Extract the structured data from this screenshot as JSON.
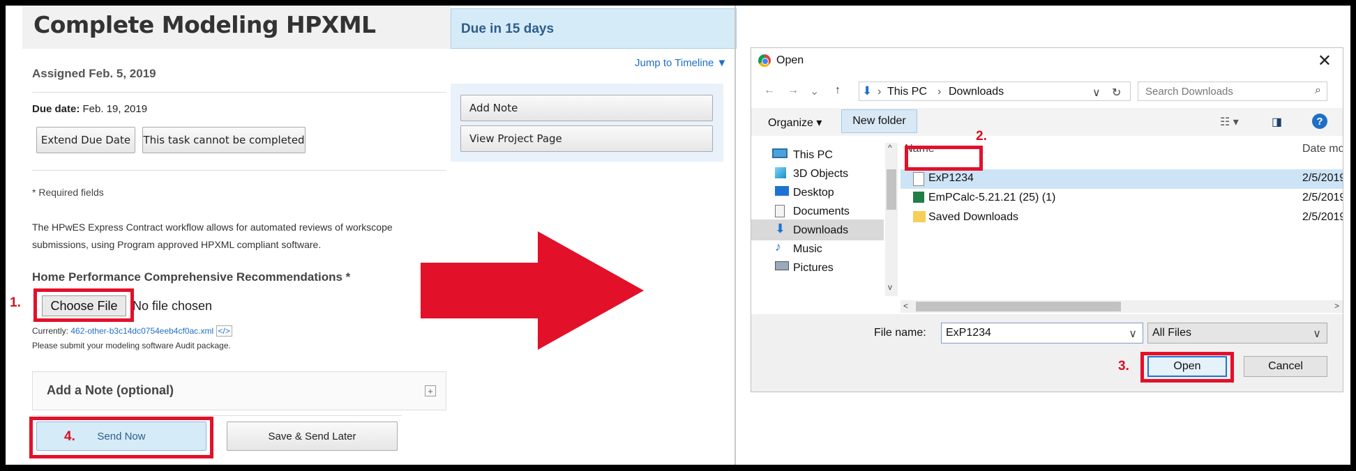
{
  "left": {
    "title": "Complete Modeling HPXML",
    "due_badge": "Due in 15 days",
    "jump_link": "Jump to Timeline ▼",
    "assigned": "Assigned Feb. 5, 2019",
    "due_date_label": "Due date:",
    "due_date_value": "Feb. 19, 2019",
    "extend_button": "Extend Due Date",
    "cannot_complete_button": "This task cannot be completed",
    "required_note": "* Required fields",
    "description": "The HPwES Express Contract workflow allows for automated reviews of workscope submissions, using Program approved HPXML compliant software.",
    "section_title": "Home Performance Comprehensive Recommendations *",
    "choose_file": "Choose File",
    "no_file": "No file chosen",
    "currently_label": "Currently:",
    "currently_file": "462-other-b3c14dc0754eeb4cf0ac.xml",
    "code_icon_text": "</>",
    "submit_note": "Please submit your modeling software Audit package.",
    "add_note_section": "Add a Note (optional)",
    "plus_icon": "+",
    "send_now": "Send Now",
    "save_later": "Save & Send Later",
    "side_add_note": "Add Note",
    "side_view_project": "View Project Page"
  },
  "steps": {
    "s1": "1.",
    "s2": "2.",
    "s3": "3.",
    "s4": "4."
  },
  "dialog": {
    "title": "Open",
    "close": "✕",
    "back": "←",
    "forward": "→",
    "recent": "⌄",
    "up": "↑",
    "crumbs": [
      "This PC",
      "›",
      "Downloads"
    ],
    "crumb_sep_first": "›",
    "addr_chevron": "∨",
    "refresh": "↻",
    "search_placeholder": "Search Downloads",
    "search_icon": "⌕",
    "organize": "Organize ▾",
    "new_folder": "New folder",
    "view_icon": "☷ ▾",
    "pane_icon": "◨",
    "help": "?",
    "tree": [
      {
        "label": "This PC"
      },
      {
        "label": "3D Objects"
      },
      {
        "label": "Desktop"
      },
      {
        "label": "Documents"
      },
      {
        "label": "Downloads"
      },
      {
        "label": "Music"
      },
      {
        "label": "Pictures"
      }
    ],
    "tree_up": "^",
    "tree_down": "v",
    "col_name": "Name",
    "col_date": "Date mo",
    "files": [
      {
        "name": "ExP1234",
        "date": "2/5/2019"
      },
      {
        "name": "EmPCalc-5.21.21 (25) (1)",
        "date": "2/5/2019"
      },
      {
        "name": "Saved Downloads",
        "date": "2/5/2019"
      }
    ],
    "h_left": "<",
    "h_right": ">",
    "file_name_label": "File name:",
    "file_name_value": "ExP1234",
    "file_type": "All Files",
    "chevron": "∨",
    "open": "Open",
    "cancel": "Cancel"
  },
  "colors": {
    "highlight_red": "#e3102a",
    "accent_blue": "#1e73d1",
    "due_blue": "#d6ebf8"
  }
}
